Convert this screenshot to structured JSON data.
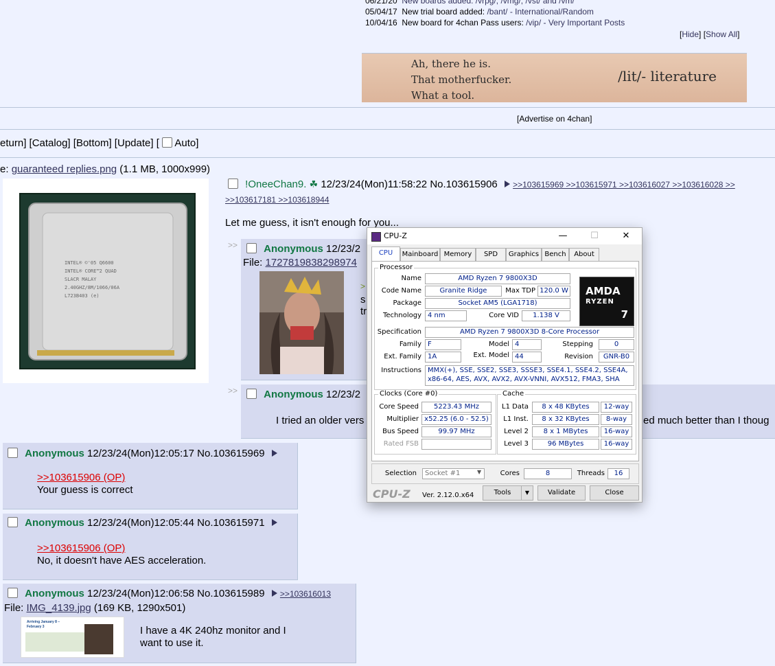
{
  "news": {
    "row0": {
      "date": "06/21/20",
      "text": "New boards added: /vrpg/, /vmg/, /vst/ and /vm/"
    },
    "row1": {
      "date": "05/04/17",
      "text_prefix": "New trial board added: ",
      "link": "/bant/ - International/Random"
    },
    "row2": {
      "date": "10/04/16",
      "text_prefix": "New board for 4chan Pass users: ",
      "link": "/vip/ - Very Important Posts"
    },
    "hide": "Hide",
    "show_all": "Show All"
  },
  "banner": {
    "line1": "Ah, there he is.",
    "line2": "That motherfucker.",
    "line3": "What a tool.",
    "board": "/lit/- literature"
  },
  "advertise": "[Advertise on 4chan]",
  "nav": {
    "return": "eturn",
    "catalog": "Catalog",
    "bottom": "Bottom",
    "update": "Update",
    "auto": "Auto"
  },
  "op": {
    "file_prefix": "e: ",
    "file_name": "guaranteed replies.png",
    "file_info": " (1.1 MB, 1000x999)",
    "name": "!OneeChan9.",
    "date": "12/23/24(Mon)11:58:22",
    "no": "No.103615906",
    "backlinks1": ">>103615969 >>103615971 >>103616027 >>103616028 >>",
    "backlinks2": ">>103617181 >>103618944",
    "comment": "Let me guess, it isn't enough for you..."
  },
  "reply1": {
    "name": "Anonymous",
    "date": "12/23/2",
    "file_prefix": "File: ",
    "file_name": "1727819838298974",
    "t1": "s",
    "t2": "tr",
    "quote_mark": ">"
  },
  "reply2": {
    "name": "Anonymous",
    "date": "12/23/2",
    "comment_left": "I tried an older vers",
    "comment_right": "ed much better than I thoug"
  },
  "post1": {
    "name": "Anonymous",
    "date": "12/23/24(Mon)12:05:17",
    "no": "No.103615969",
    "quote": ">>103615906 (OP)",
    "comment": "Your guess is correct"
  },
  "post2": {
    "name": "Anonymous",
    "date": "12/23/24(Mon)12:05:44",
    "no": "No.103615971",
    "quote": ">>103615906 (OP)",
    "comment": "No, it doesn't have AES acceleration."
  },
  "post3": {
    "name": "Anonymous",
    "date": "12/23/24(Mon)12:06:58",
    "no": "No.103615989",
    "backlink": ">>103616013",
    "file_prefix": "File: ",
    "file_name": "IMG_4139.jpg",
    "file_info": " (169 KB, 1290x501)",
    "comment1": "I have a 4K 240hz monitor and I",
    "comment2": "want to use it.",
    "thumb_text": "Arriving January 8 – February 3"
  },
  "cpuz": {
    "title": "CPU-Z",
    "tabs": [
      "CPU",
      "Mainboard",
      "Memory",
      "SPD",
      "Graphics",
      "Bench",
      "About"
    ],
    "processor_group": "Processor",
    "name_label": "Name",
    "name": "AMD Ryzen 7 9800X3D",
    "codename_label": "Code Name",
    "codename": "Granite Ridge",
    "maxtdp_label": "Max TDP",
    "maxtdp": "120.0 W",
    "package_label": "Package",
    "package": "Socket AM5 (LGA1718)",
    "tech_label": "Technology",
    "tech": "4 nm",
    "corevid_label": "Core VID",
    "corevid": "1.138 V",
    "spec_label": "Specification",
    "spec": "AMD Ryzen 7 9800X3D 8-Core Processor",
    "family_label": "Family",
    "family": "F",
    "model_label": "Model",
    "model": "4",
    "stepping_label": "Stepping",
    "stepping": "0",
    "extfamily_label": "Ext. Family",
    "extfamily": "1A",
    "extmodel_label": "Ext. Model",
    "extmodel": "44",
    "revision_label": "Revision",
    "revision": "GNR-B0",
    "instr_label": "Instructions",
    "instr1": "MMX(+), SSE, SSE2, SSE3, SSSE3, SSE4.1, SSE4.2, SSE4A,",
    "instr2": "x86-64, AES, AVX, AVX2, AVX-VNNI, AVX512, FMA3, SHA",
    "logo_amd": "AMDA",
    "logo_ryzen": "RYZEN",
    "logo_num": "7",
    "clocks_group": "Clocks (Core #0)",
    "corespeed_label": "Core Speed",
    "corespeed": "5223.43 MHz",
    "multiplier_label": "Multiplier",
    "multiplier": "x52.25 (6.0 - 52.5)",
    "busspeed_label": "Bus Speed",
    "busspeed": "99.97 MHz",
    "ratedfsb_label": "Rated FSB",
    "ratedfsb": "",
    "cache_group": "Cache",
    "l1d_label": "L1 Data",
    "l1d": "8 x 48 KBytes",
    "l1d_way": "12-way",
    "l1i_label": "L1 Inst.",
    "l1i": "8 x 32 KBytes",
    "l1i_way": "8-way",
    "l2_label": "Level 2",
    "l2": "8 x 1 MBytes",
    "l2_way": "16-way",
    "l3_label": "Level 3",
    "l3": "96 MBytes",
    "l3_way": "16-way",
    "selection_label": "Selection",
    "selection": "Socket #1",
    "cores_label": "Cores",
    "cores": "8",
    "threads_label": "Threads",
    "threads": "16",
    "brand": "CPU-Z",
    "version": "Ver. 2.12.0.x64",
    "tools": "Tools",
    "validate": "Validate",
    "close": "Close"
  }
}
